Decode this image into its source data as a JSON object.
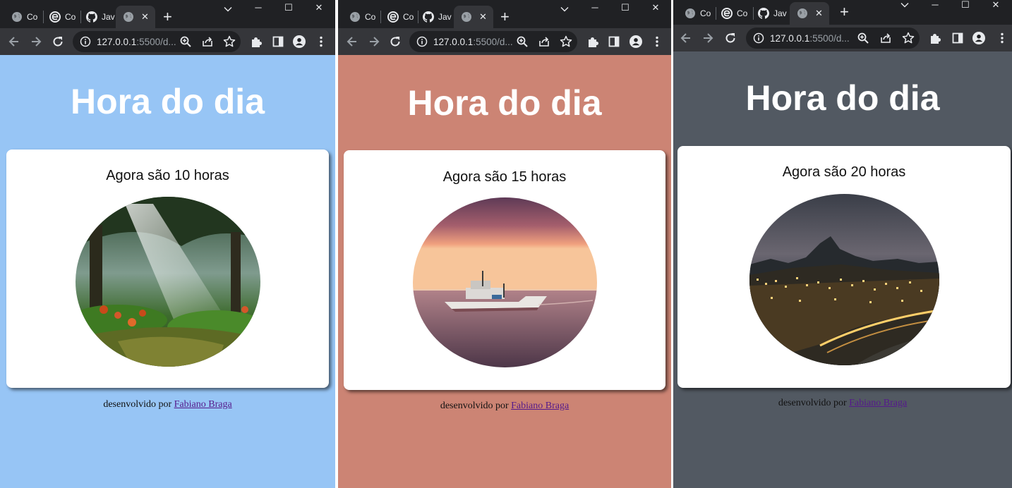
{
  "browser": {
    "tabs": [
      {
        "label": "Co",
        "icon": "globe-icon"
      },
      {
        "label": "Co",
        "icon": "edge-c-icon"
      },
      {
        "label": "Jav",
        "icon": "github-icon"
      },
      {
        "label": "",
        "icon": "globe-icon",
        "active": true
      }
    ],
    "new_tab_label": "+",
    "address": {
      "host": "127.0.0.1",
      "rest": ":5500/d..."
    }
  },
  "windows": [
    {
      "id": "morning",
      "background_color": "#97c5f5",
      "heading": "Hora do dia",
      "time_message": "Agora são 10 horas",
      "image": "forest-sunbeams",
      "footer_prefix": "desenvolvido por",
      "footer_link": "Fabiano Braga"
    },
    {
      "id": "afternoon",
      "background_color": "#cc8474",
      "heading": "Hora do dia",
      "time_message": "Agora são 15 horas",
      "image": "boat-at-sunset",
      "footer_prefix": "desenvolvido por",
      "footer_link": "Fabiano Braga"
    },
    {
      "id": "night",
      "background_color": "#525962",
      "heading": "Hora do dia",
      "time_message": "Agora são 20 horas",
      "image": "city-at-night",
      "footer_prefix": "desenvolvido por",
      "footer_link": "Fabiano Braga"
    }
  ]
}
